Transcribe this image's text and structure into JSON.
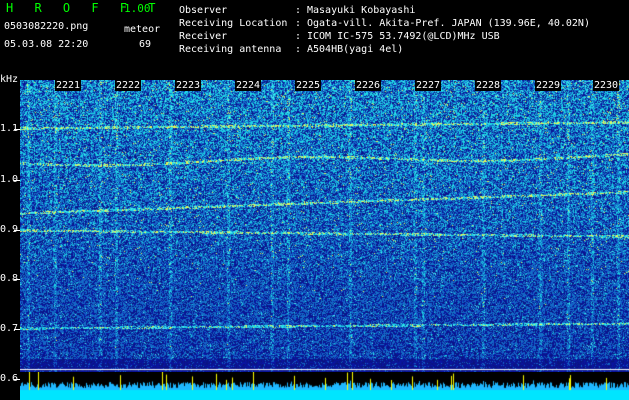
{
  "header": {
    "app_title": "H R O F F T",
    "version": "1.00",
    "file_name": "0503082220.png",
    "mode": "meteor",
    "datetime": "05.03.08 22:20",
    "count": "69"
  },
  "info": [
    {
      "key": "Observer",
      "value": "Masayuki Kobayashi"
    },
    {
      "key": "Receiving Location",
      "value": "Ogata-vill. Akita-Pref. JAPAN (139.96E, 40.02N)"
    },
    {
      "key": "Receiver",
      "value": "ICOM IC-575 53.7492(@LCD)MHz USB"
    },
    {
      "key": "Receiving antenna",
      "value": "A504HB(yagi 4el)"
    }
  ],
  "spectrogram": {
    "y_unit": "kHz",
    "y_labels": [
      "1.1",
      "1.0",
      "0.9",
      "0.8",
      "0.7",
      "0.6"
    ],
    "x_labels": [
      "2221",
      "2222",
      "2223",
      "2224",
      "2225",
      "2226",
      "2227",
      "2228",
      "2229",
      "2230"
    ],
    "colors": {
      "bg": "#000000",
      "deep": "#10208c",
      "mid": "#1e56d8",
      "hot": "#00ffff",
      "peak": "#ffff00",
      "title": "#00ff00"
    }
  }
}
